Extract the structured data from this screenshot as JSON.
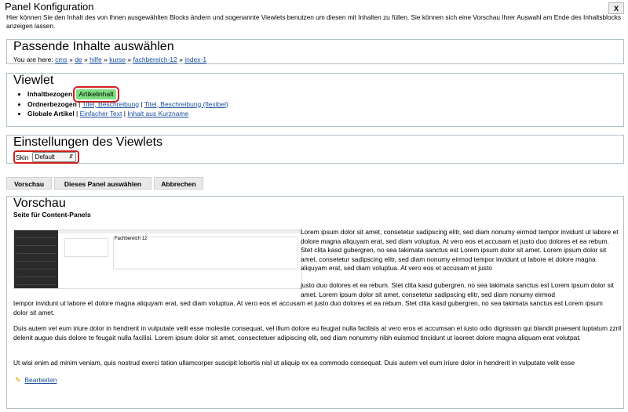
{
  "window": {
    "title": "Panel Konfiguration",
    "close_label": "X",
    "intro": "Hier können Sie den Inhalt des von Ihnen ausgewählten Blocks ändern und sogenannte Viewlets benutzen um diesen mit Inhalten zu füllen. Sie können sich eine Vorschau Ihrer Auswahl am Ende des Inhaltsblocks anzeigen lassen."
  },
  "passende": {
    "heading": "Passende Inhalte auswählen",
    "you_are_here": "You are here:",
    "crumbs": [
      "cms",
      "de",
      "hilfe",
      "kurse",
      "fachbereich-12",
      "index-1"
    ],
    "separator": "»"
  },
  "viewlet": {
    "heading": "Viewlet",
    "rows": [
      {
        "label": "Inhaltbezogen",
        "options": [
          "Artikelinhalt"
        ]
      },
      {
        "label": "Ordnerbezogen",
        "options": [
          "Titel, Beschreibung",
          "Titel, Beschreibung (flexibel)"
        ]
      },
      {
        "label": "Globale Artikel",
        "options": [
          "Einfacher Text",
          "Inhalt aus Kurzname"
        ]
      }
    ],
    "selected": "Artikelinhalt",
    "highlight_color": "#7ede7e",
    "outline_color": "#d21d1d"
  },
  "einstellungen": {
    "heading": "Einstellungen des Viewlets",
    "skin_label": "Skin",
    "skin_value": "Default"
  },
  "actions": {
    "preview": "Vorschau",
    "select_panel": "Dieses Panel auswählen",
    "cancel": "Abbrechen"
  },
  "vorschau": {
    "heading": "Vorschau",
    "subtitle": "Seite für Content-Panels",
    "thumb_title": "Fachbereich 12",
    "para1_right": "Lorem ipsum dolor sit amet, consetetur sadipscing elitr, sed diam nonumy eirmod tempor invidunt ut labore et dolore magna aliquyam erat, sed diam voluptua. At vero eos et accusam et justo duo dolores et ea rebum. Stet clita kasd gubergren, no sea takimata sanctus est Lorem ipsum dolor sit amet. Lorem ipsum dolor sit amet, consetetur sadipscing elitr, sed diam nonumy eirmod tempor invidunt ut labore et dolore magna aliquyam erat, sed diam voluptua. At vero eos et accusam et justo",
    "para1_cont": "justo duo dolores et ea rebum. Stet clita kasd gubergren, no sea takimata sanctus est Lorem ipsum dolor sit amet. Lorem ipsum dolor sit amet, consetetur sadipscing elitr, sed diam nonumy eirmod",
    "para1_full": "tempor invidunt ut labore et dolore magna aliquyam erat, sed diam voluptua. At vero eos et accusam et justo duo dolores et ea rebum. Stet clita kasd gubergren, no sea takimata sanctus est Lorem ipsum dolor sit amet.",
    "para2": "Duis autem vel eum iriure dolor in hendrerit in vulputate velit esse molestie consequat, vel illum dolore eu feugiat nulla facilisis at vero eros et accumsan et iusto odio dignissim qui blandit praesent luptatum zzril delenit augue duis dolore te feugait nulla facilisi. Lorem ipsum dolor sit amet, consectetuer adipiscing elit, sed diam nonummy nibh euismod tincidunt ut laoreet dolore magna aliquam erat volutpat.",
    "para3": "Ut wisi enim ad minim veniam, quis nostrud exerci tation ullamcorper suscipit lobortis nisl ut aliquip ex ea commodo consequat. Duis autem vel eum iriure dolor in hendrerit in vulputate velit esse",
    "edit_label": "Bearbeiten"
  }
}
